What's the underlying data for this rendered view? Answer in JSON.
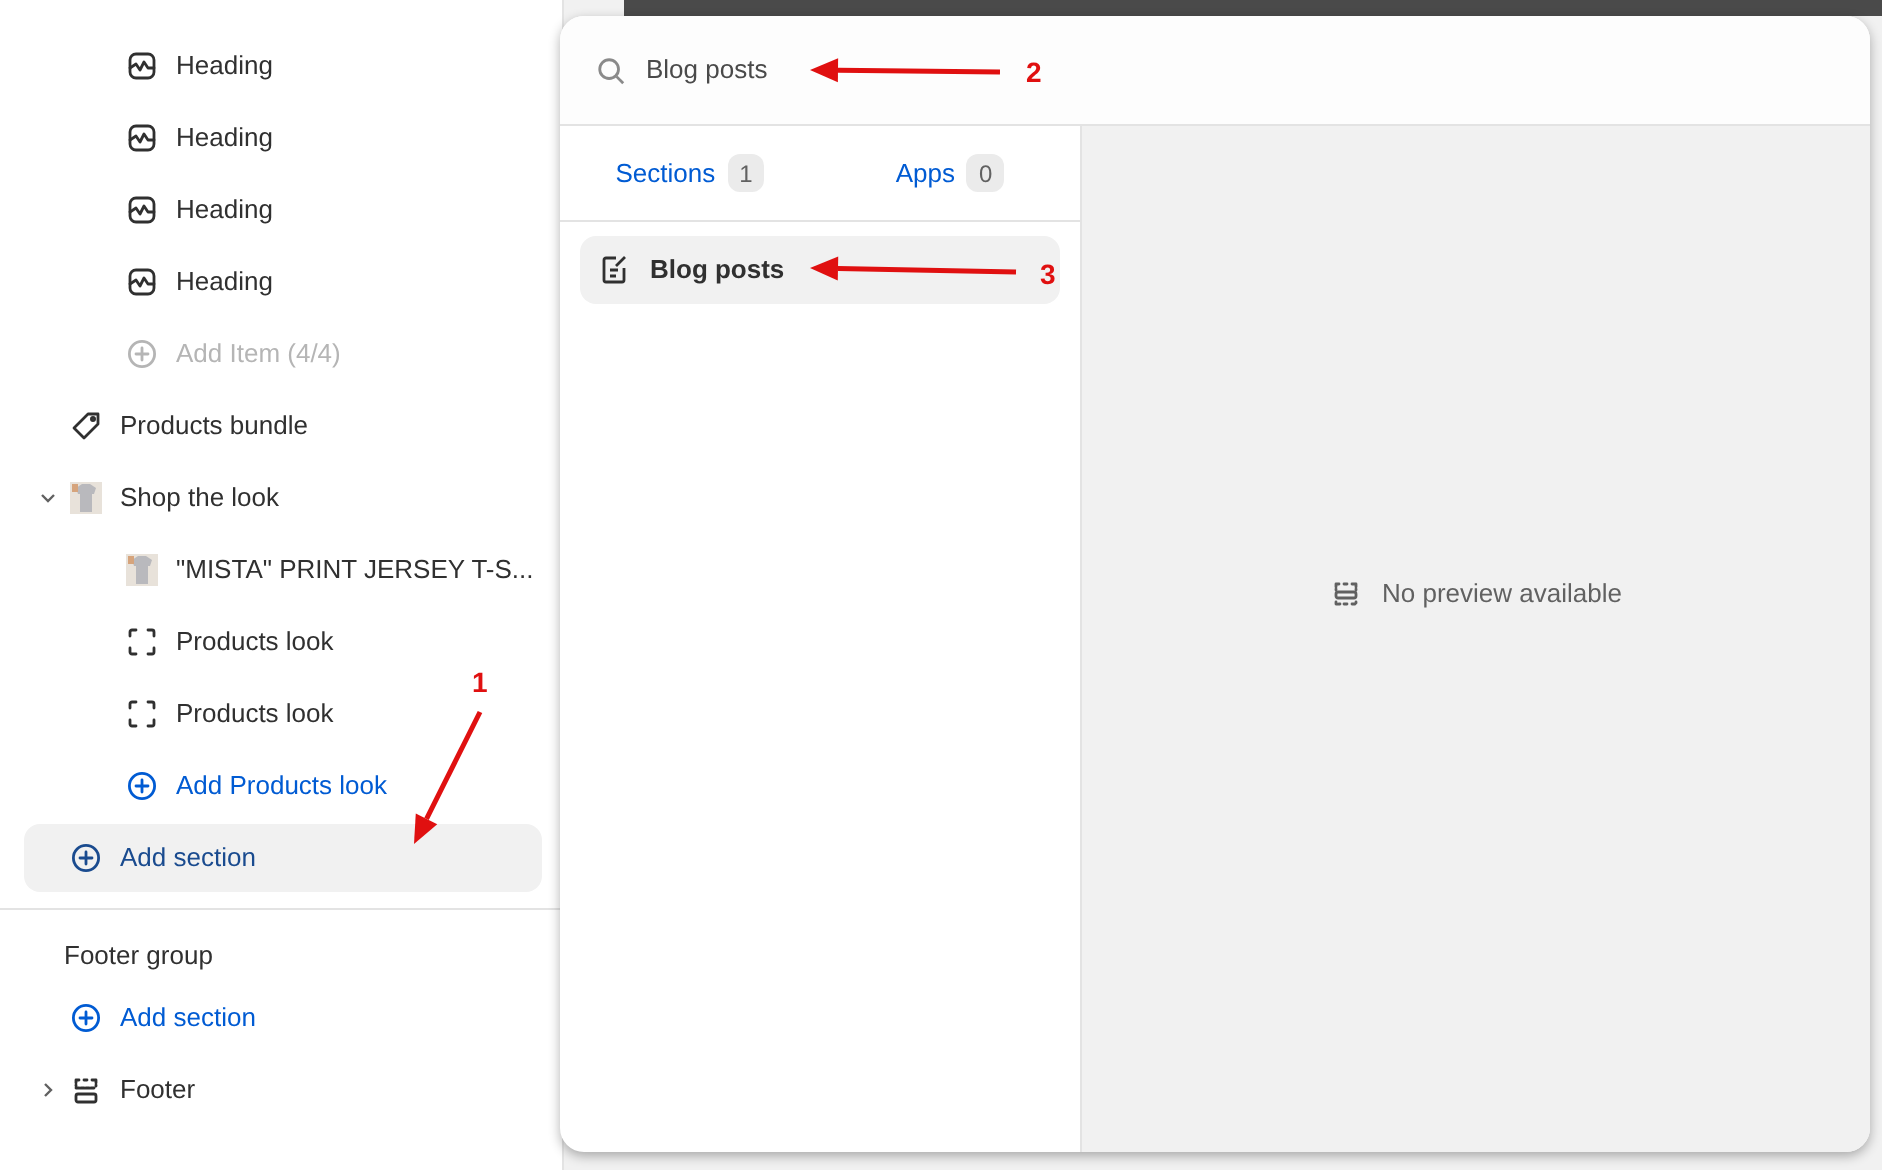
{
  "sidebar": {
    "sections": [
      {
        "children": [
          {
            "kind": "block",
            "label": "Heading"
          },
          {
            "kind": "block",
            "label": "Heading"
          },
          {
            "kind": "block",
            "label": "Heading"
          },
          {
            "kind": "block",
            "label": "Heading"
          },
          {
            "kind": "add",
            "label": "Add Item (4/4)",
            "disabled": true
          }
        ]
      },
      {
        "kind": "bundle",
        "label": "Products bundle"
      },
      {
        "kind": "product",
        "label": "Shop the look",
        "expanded": true,
        "children": [
          {
            "kind": "product",
            "label": "\"MISTA\" PRINT JERSEY T-S..."
          },
          {
            "kind": "look",
            "label": "Products look"
          },
          {
            "kind": "look",
            "label": "Products look"
          },
          {
            "kind": "add",
            "label": "Add Products look",
            "disabled": false
          }
        ]
      },
      {
        "kind": "add-section",
        "label": "Add section",
        "selected": true
      }
    ],
    "footer_group": {
      "title": "Footer group",
      "add_label": "Add section",
      "sections": [
        {
          "kind": "footer",
          "label": "Footer",
          "expanded": false
        }
      ]
    }
  },
  "modal": {
    "search": {
      "value": "Blog posts"
    },
    "tabs": [
      {
        "label": "Sections",
        "count": "1"
      },
      {
        "label": "Apps",
        "count": "0"
      }
    ],
    "results": [
      {
        "label": "Blog posts",
        "selected": true
      }
    ],
    "preview": {
      "text": "No preview available"
    }
  },
  "annotations": [
    {
      "label": "1"
    },
    {
      "label": "2"
    },
    {
      "label": "3"
    }
  ]
}
